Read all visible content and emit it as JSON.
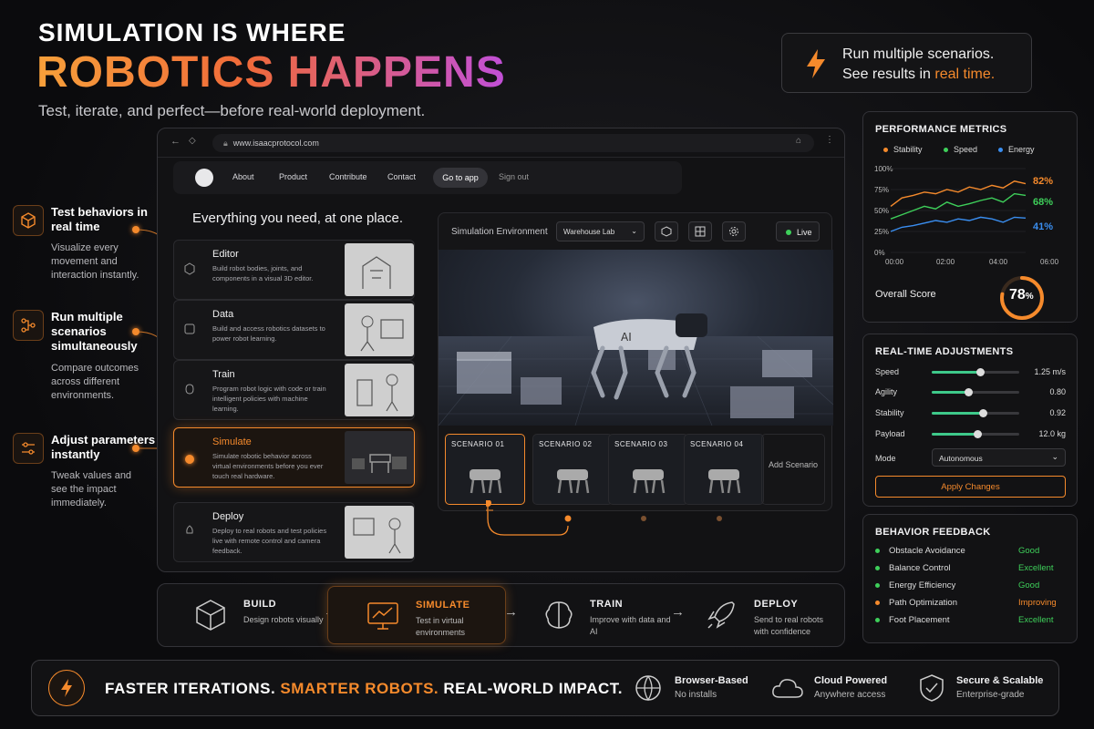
{
  "hero": {
    "line1": "SIMULATION IS WHERE",
    "line2": "ROBOTICS HAPPENS",
    "sub": "Test, iterate, and perfect—before real-world deployment."
  },
  "callout": {
    "line1": "Run multiple scenarios.",
    "line2a": "See results in ",
    "line2b": "real time."
  },
  "features": [
    {
      "title": "Test behaviors in real time",
      "desc": "Visualize every movement and interaction instantly.",
      "icon": "cube-icon"
    },
    {
      "title": "Run multiple scenarios simultaneously",
      "desc": "Compare outcomes across different environments.",
      "icon": "flow-icon"
    },
    {
      "title": "Adjust parameters instantly",
      "desc": "Tweak values and see the impact immediately.",
      "icon": "sliders-icon"
    }
  ],
  "browser": {
    "url": "www.isaacprotocol.com",
    "nav": [
      "About",
      "Product",
      "Contribute",
      "Contact"
    ],
    "go_app": "Go to app",
    "sign_out": "Sign out",
    "heading": "Everything you need, at one place."
  },
  "cards": [
    {
      "title": "Editor",
      "desc": "Build robot bodies, joints, and components in a visual 3D editor."
    },
    {
      "title": "Data",
      "desc": "Build and access robotics datasets to power robot learning."
    },
    {
      "title": "Train",
      "desc": "Program robot logic with code or train intelligent policies with machine learning."
    },
    {
      "title": "Simulate",
      "desc": "Simulate robotic behavior across virtual environments before you ever touch real hardware."
    },
    {
      "title": "Deploy",
      "desc": "Deploy to real robots and test policies live with remote control and camera feedback."
    }
  ],
  "sim": {
    "label": "Simulation Environment",
    "environment": "Warehouse Lab",
    "live": "Live",
    "robot_mark": "AI",
    "scenarios": [
      "SCENARIO 01",
      "SCENARIO 02",
      "SCENARIO 03",
      "SCENARIO 04"
    ],
    "add": "Add Scenario"
  },
  "metrics": {
    "title": "PERFORMANCE METRICS",
    "legend": [
      "Stability",
      "Speed",
      "Energy"
    ],
    "yticks": [
      "100%",
      "75%",
      "50%",
      "25%",
      "0%"
    ],
    "xticks": [
      "00:00",
      "02:00",
      "04:00",
      "06:00"
    ],
    "end_labels": [
      "82%",
      "68%",
      "41%"
    ],
    "overall_label": "Overall Score",
    "overall_value": "78",
    "overall_unit": "%",
    "overall_fraction": 0.78
  },
  "chart_data": {
    "type": "line",
    "x": [
      "00:00",
      "00:30",
      "01:00",
      "01:30",
      "02:00",
      "02:30",
      "03:00",
      "03:30",
      "04:00",
      "04:30",
      "05:00",
      "05:30",
      "06:00"
    ],
    "series": [
      {
        "name": "Stability",
        "color": "#f58a2c",
        "values": [
          55,
          65,
          68,
          72,
          70,
          75,
          72,
          78,
          75,
          80,
          77,
          85,
          82
        ]
      },
      {
        "name": "Speed",
        "color": "#3ecf5a",
        "values": [
          40,
          45,
          50,
          55,
          52,
          60,
          55,
          58,
          62,
          65,
          60,
          70,
          68
        ]
      },
      {
        "name": "Energy",
        "color": "#3a8ef0",
        "values": [
          25,
          30,
          32,
          35,
          38,
          36,
          40,
          38,
          42,
          40,
          36,
          42,
          41
        ]
      }
    ],
    "ylim": [
      0,
      100
    ]
  },
  "adjust": {
    "title": "REAL-TIME ADJUSTMENTS",
    "sliders": [
      {
        "label": "Speed",
        "value": "1.25 m/s",
        "fraction": 0.55
      },
      {
        "label": "Agility",
        "value": "0.80",
        "fraction": 0.42
      },
      {
        "label": "Stability",
        "value": "0.92",
        "fraction": 0.58
      },
      {
        "label": "Payload",
        "value": "12.0 kg",
        "fraction": 0.52
      }
    ],
    "mode_label": "Mode",
    "mode_value": "Autonomous",
    "apply": "Apply Changes"
  },
  "feedback": {
    "title": "BEHAVIOR FEEDBACK",
    "rows": [
      {
        "label": "Obstacle Avoidance",
        "value": "Good",
        "color": "#3ecf5a"
      },
      {
        "label": "Balance Control",
        "value": "Excellent",
        "color": "#3ecf5a"
      },
      {
        "label": "Energy Efficiency",
        "value": "Good",
        "color": "#3ecf5a"
      },
      {
        "label": "Path Optimization",
        "value": "Improving",
        "color": "#f58a2c"
      },
      {
        "label": "Foot Placement",
        "value": "Excellent",
        "color": "#3ecf5a"
      }
    ]
  },
  "pipeline": [
    {
      "name": "BUILD",
      "desc": "Design robots visually"
    },
    {
      "name": "SIMULATE",
      "desc": "Test in virtual environments"
    },
    {
      "name": "TRAIN",
      "desc": "Improve with data and AI"
    },
    {
      "name": "DEPLOY",
      "desc": "Send to real robots with confidence"
    }
  ],
  "footer": {
    "tag1": "FASTER ITERATIONS. ",
    "tag2": "SMARTER ROBOTS.",
    "tag3": " REAL-WORLD IMPACT.",
    "items": [
      {
        "title": "Browser-Based",
        "sub": "No installs",
        "icon": "globe-icon"
      },
      {
        "title": "Cloud Powered",
        "sub": "Anywhere access",
        "icon": "cloud-icon"
      },
      {
        "title": "Secure & Scalable",
        "sub": "Enterprise-grade",
        "icon": "shield-check-icon"
      }
    ]
  }
}
